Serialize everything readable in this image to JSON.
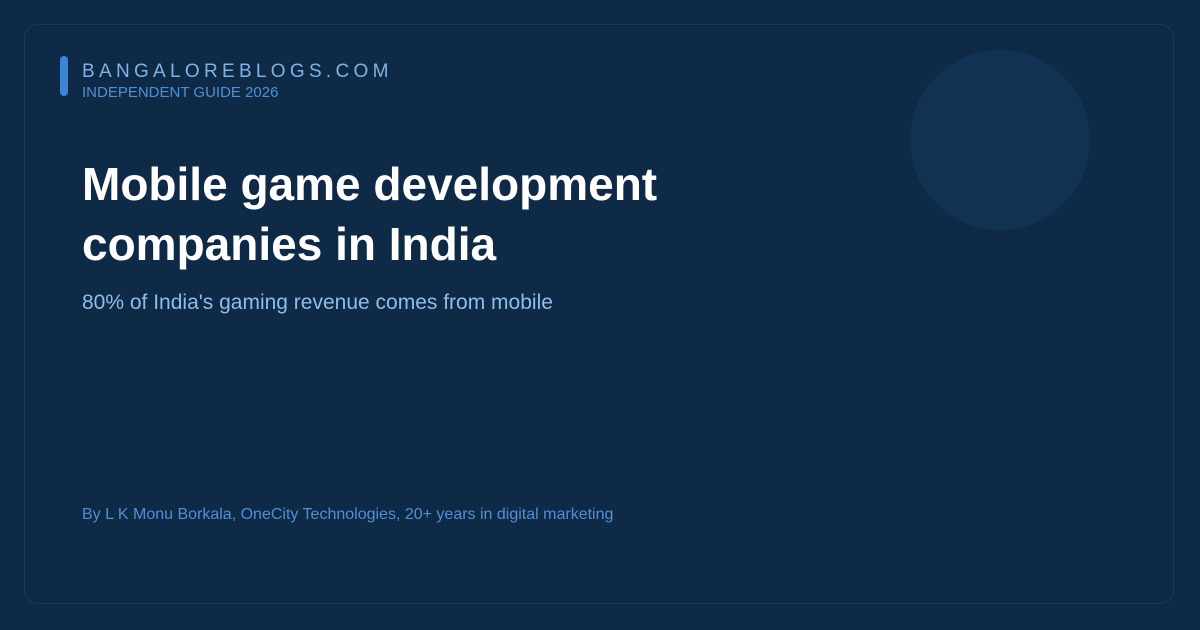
{
  "header": {
    "brand": "BANGALOREBLOGS.COM",
    "tagline": "INDEPENDENT GUIDE 2026"
  },
  "main": {
    "title_line1": "Mobile game development",
    "title_line2": "companies in India",
    "subtitle": "80% of India's gaming revenue comes from mobile"
  },
  "footer": {
    "byline": "By L K Monu Borkala, OneCity Technologies, 20+ years in digital marketing"
  },
  "colors": {
    "background": "#0f2a47",
    "accent": "#3b86d9",
    "brand_text": "#7fb3e6",
    "title_text": "#ffffff",
    "subtitle_text": "#8fbde9",
    "muted_text": "#4f90d4"
  }
}
